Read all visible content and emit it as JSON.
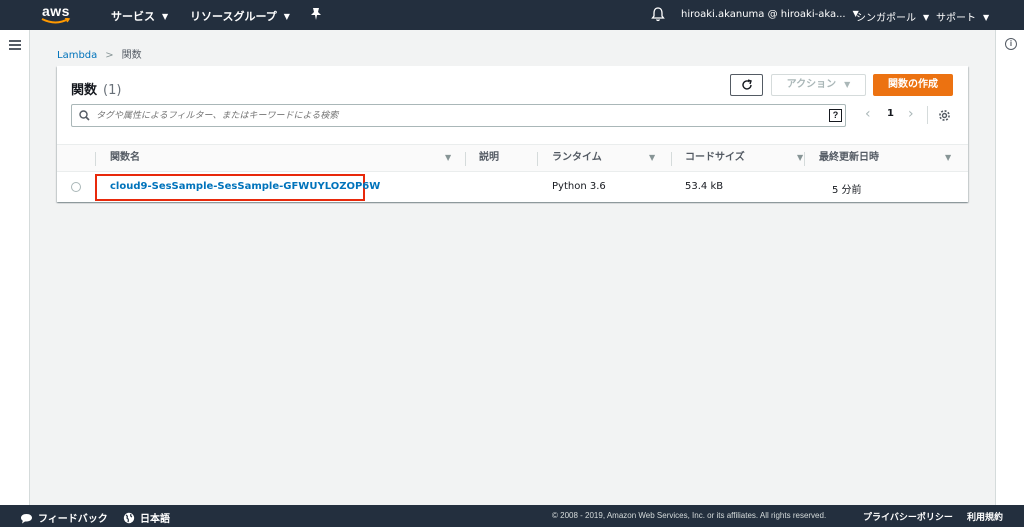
{
  "nav": {
    "logo_text": "aws",
    "services": "サービス",
    "resource_groups": "リソースグループ",
    "account": "hiroaki.akanuma @ hiroaki-aka...",
    "region": "シンガポール",
    "support": "サポート"
  },
  "breadcrumb": {
    "root": "Lambda",
    "current": "関数"
  },
  "panel": {
    "title": "関数",
    "count": "(1)",
    "action_label": "アクション",
    "create_label": "関数の作成",
    "search_placeholder": "タグや属性によるフィルター、またはキーワードによる検索",
    "help_glyph": "?",
    "page": "1"
  },
  "table": {
    "columns": [
      "関数名",
      "説明",
      "ランタイム",
      "コードサイズ",
      "最終更新日時"
    ],
    "rows": [
      {
        "name": "cloud9-SesSample-SesSample-GFWUYLOZOP6W",
        "description": "",
        "runtime": "Python 3.6",
        "code_size": "53.4 kB",
        "last_modified": "5 分前"
      }
    ]
  },
  "footer": {
    "feedback": "フィードバック",
    "language": "日本語",
    "copyright": "© 2008 - 2019, Amazon Web Services, Inc. or its affiliates. All rights reserved.",
    "privacy": "プライバシーポリシー",
    "terms": "利用規約"
  },
  "colors": {
    "nav_bg": "#232f3e",
    "primary_orange": "#ec7211",
    "link_blue": "#0073bb",
    "highlight_red": "#e8290b"
  }
}
